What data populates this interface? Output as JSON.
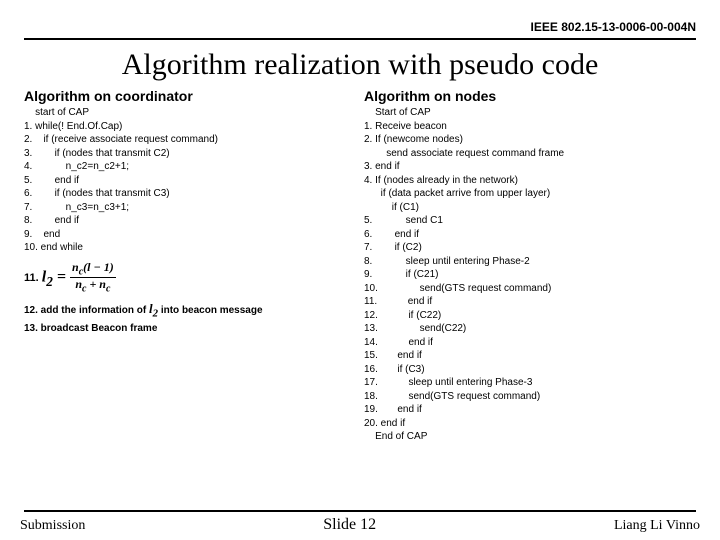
{
  "doc_id": "IEEE 802.15-13-0006-00-004N",
  "title": "Algorithm realization with pseudo code",
  "left": {
    "heading": "Algorithm on coordinator",
    "code": "    start of CAP\n1. while(! End.Of.Cap)\n2.    if (receive associate request command)\n3.        if (nodes that transmit C2)\n4.            n_c2=n_c2+1;\n5.        end if\n6.        if (nodes that transmit C3)\n7.            n_c3=n_c3+1;\n8.        end if\n9.    end\n10. end while",
    "step11_label": "11.",
    "formula_lhs": "l",
    "formula_sub": "2",
    "frac_num_a": "n",
    "frac_num_a_sub": "c",
    "frac_num_tail": "(l − 1)",
    "frac_den_a": "n",
    "frac_den_a_sub": "c",
    "frac_den_plus": " + ",
    "frac_den_b": "n",
    "frac_den_b_sub": "c",
    "step12": "12.  add the information of ",
    "step12_tail": " into beacon message",
    "step13": "13. broadcast Beacon frame"
  },
  "right": {
    "heading": "Algorithm on nodes",
    "code": "    Start of CAP\n1. Receive beacon\n2. If (newcome nodes)\n        send associate request command frame\n3. end if\n4. If (nodes already in the network)\n      if (data packet arrive from upper layer)\n          if (C1)\n5.            send C1\n6.        end if\n7.        if (C2)\n8.            sleep until entering Phase-2\n9.            if (C21)\n10.               send(GTS request command)\n11.           end if\n12.           if (C22)\n13.               send(C22)\n14.           end if\n15.       end if\n16.       if (C3)\n17.           sleep until entering Phase-3\n18.           send(GTS request command)\n19.       end if\n20. end if\n    End of CAP"
  },
  "footer": {
    "left": "Submission",
    "center": "Slide 12",
    "right": "Liang Li Vinno"
  }
}
